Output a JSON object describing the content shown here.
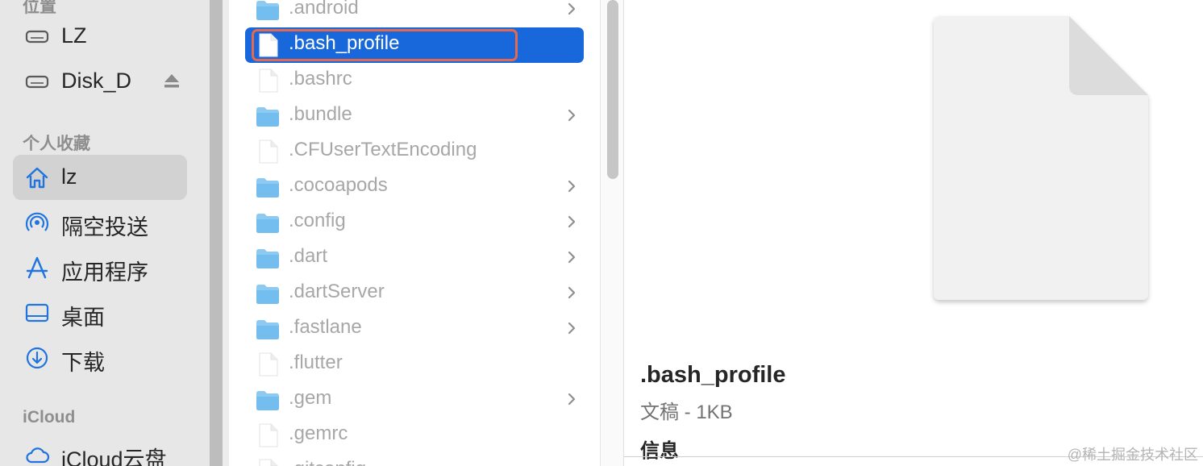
{
  "sidebar": {
    "locations_heading": "位置",
    "favorites_heading": "个人收藏",
    "icloud_heading": "iCloud",
    "locations": [
      {
        "label": "LZ",
        "icon": "drive-icon"
      },
      {
        "label": "Disk_D",
        "icon": "drive-icon",
        "ejectable": true
      }
    ],
    "favorites": [
      {
        "label": "lz",
        "icon": "home-icon",
        "selected": true
      },
      {
        "label": "隔空投送",
        "icon": "airdrop-icon"
      },
      {
        "label": "应用程序",
        "icon": "applications-icon"
      },
      {
        "label": "桌面",
        "icon": "desktop-icon"
      },
      {
        "label": "下载",
        "icon": "downloads-icon"
      }
    ],
    "icloud": [
      {
        "label": "iCloud云盘",
        "icon": "cloud-icon"
      }
    ]
  },
  "file_list": {
    "items": [
      {
        "name": ".android",
        "kind": "folder"
      },
      {
        "name": ".bash_profile",
        "kind": "file",
        "selected": true
      },
      {
        "name": ".bashrc",
        "kind": "file"
      },
      {
        "name": ".bundle",
        "kind": "folder"
      },
      {
        "name": ".CFUserTextEncoding",
        "kind": "file"
      },
      {
        "name": ".cocoapods",
        "kind": "folder"
      },
      {
        "name": ".config",
        "kind": "folder"
      },
      {
        "name": ".dart",
        "kind": "folder"
      },
      {
        "name": ".dartServer",
        "kind": "folder"
      },
      {
        "name": ".fastlane",
        "kind": "folder"
      },
      {
        "name": ".flutter",
        "kind": "file"
      },
      {
        "name": ".gem",
        "kind": "folder"
      },
      {
        "name": ".gemrc",
        "kind": "file"
      },
      {
        "name": ".gitconfig",
        "kind": "file"
      }
    ]
  },
  "preview": {
    "file_name": ".bash_profile",
    "meta": "文稿 - 1KB",
    "info_heading": "信息"
  },
  "watermark": "@稀土掘金技术社区",
  "colors": {
    "selection": "#1868dc",
    "highlight_outline": "#e46a4f",
    "folder": "#7ec1f0"
  }
}
